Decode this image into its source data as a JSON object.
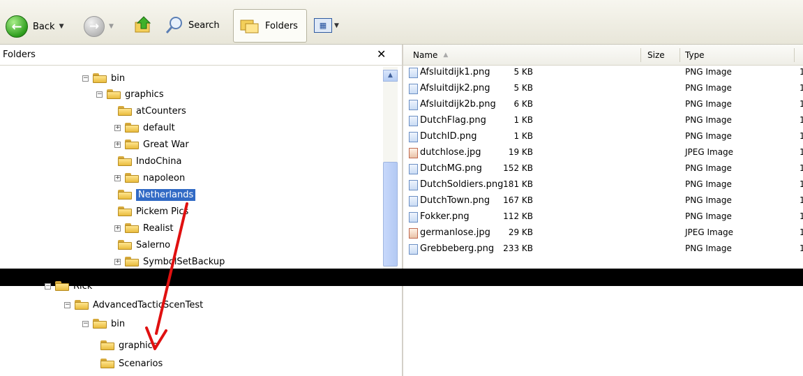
{
  "toolbar": {
    "back_label": "Back",
    "search_label": "Search",
    "folders_label": "Folders"
  },
  "folders_pane": {
    "title": "Folders"
  },
  "tree_top": [
    {
      "label": "bin",
      "expander": "⊟"
    },
    {
      "label": "graphics",
      "expander": "⊟"
    },
    {
      "label": "atCounters",
      "expander": ""
    },
    {
      "label": "default",
      "expander": "⊞"
    },
    {
      "label": "Great War",
      "expander": "⊞"
    },
    {
      "label": "IndoChina",
      "expander": ""
    },
    {
      "label": "napoleon",
      "expander": "⊞"
    },
    {
      "label": "Netherlands",
      "expander": ""
    },
    {
      "label": "Pickem Pics",
      "expander": ""
    },
    {
      "label": "Realist",
      "expander": "⊞"
    },
    {
      "label": "Salerno",
      "expander": ""
    },
    {
      "label": "SymbolSetBackup",
      "expander": "⊞"
    }
  ],
  "tree_bottom": [
    {
      "label": "Rick",
      "expander": "⊟"
    },
    {
      "label": "AdvancedTacticScenTest",
      "expander": "⊟"
    },
    {
      "label": "bin",
      "expander": "⊟"
    },
    {
      "label": "graphics",
      "expander": ""
    },
    {
      "label": "Scenarios",
      "expander": ""
    }
  ],
  "list_columns": {
    "name": "Name",
    "size": "Size",
    "type": "Type"
  },
  "files": [
    {
      "name": "Afsluitdijk1.png",
      "size": "5 KB",
      "type": "PNG Image",
      "kind": "png",
      "extra": "1"
    },
    {
      "name": "Afsluitdijk2.png",
      "size": "5 KB",
      "type": "PNG Image",
      "kind": "png",
      "extra": "1"
    },
    {
      "name": "Afsluitdijk2b.png",
      "size": "6 KB",
      "type": "PNG Image",
      "kind": "png",
      "extra": "1"
    },
    {
      "name": "DutchFlag.png",
      "size": "1 KB",
      "type": "PNG Image",
      "kind": "png",
      "extra": "1"
    },
    {
      "name": "DutchID.png",
      "size": "1 KB",
      "type": "PNG Image",
      "kind": "png",
      "extra": "1"
    },
    {
      "name": "dutchlose.jpg",
      "size": "19 KB",
      "type": "JPEG Image",
      "kind": "jpg",
      "extra": "1"
    },
    {
      "name": "DutchMG.png",
      "size": "152 KB",
      "type": "PNG Image",
      "kind": "png",
      "extra": "1"
    },
    {
      "name": "DutchSoldiers.png",
      "size": "181 KB",
      "type": "PNG Image",
      "kind": "png",
      "extra": "1"
    },
    {
      "name": "DutchTown.png",
      "size": "167 KB",
      "type": "PNG Image",
      "kind": "png",
      "extra": "1"
    },
    {
      "name": "Fokker.png",
      "size": "112 KB",
      "type": "PNG Image",
      "kind": "png",
      "extra": "1"
    },
    {
      "name": "germanlose.jpg",
      "size": "29 KB",
      "type": "JPEG Image",
      "kind": "jpg",
      "extra": "1"
    },
    {
      "name": "Grebbeberg.png",
      "size": "233 KB",
      "type": "PNG Image",
      "kind": "png",
      "extra": "1"
    }
  ],
  "colors": {
    "selection": "#316ac5",
    "arrow": "#e01010"
  }
}
